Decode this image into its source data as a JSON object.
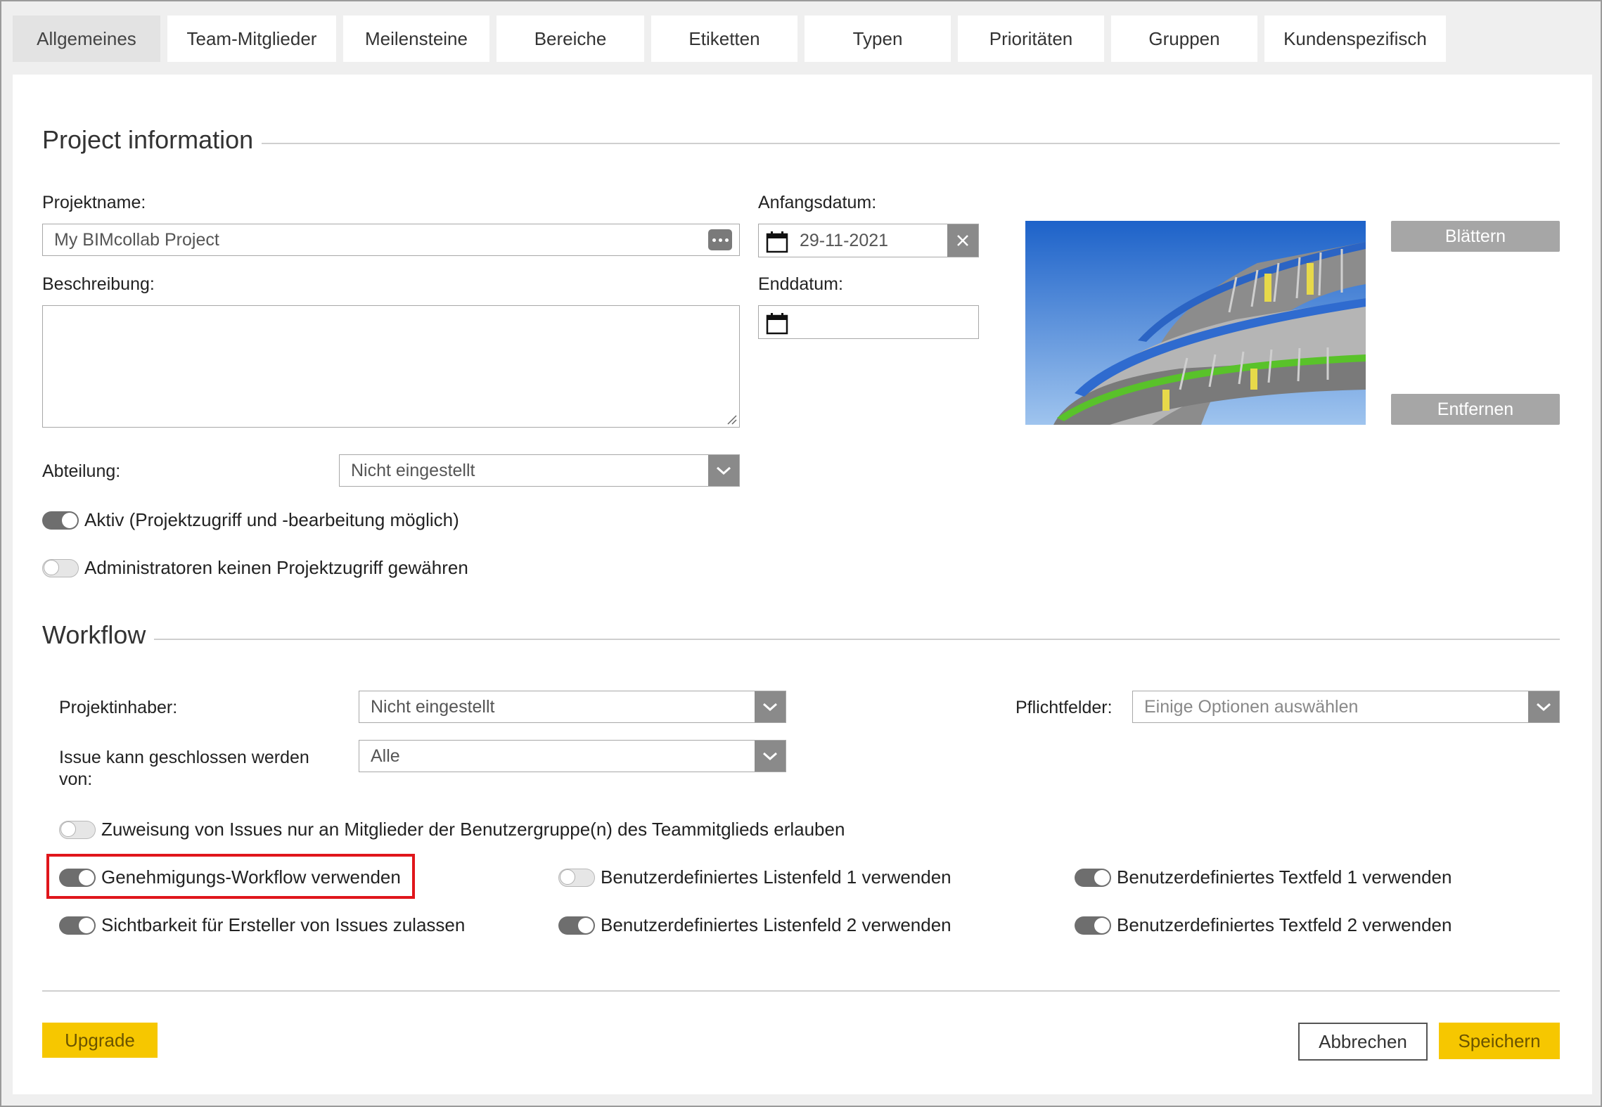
{
  "tabs": [
    {
      "label": "Allgemeines",
      "active": true
    },
    {
      "label": "Team-Mitglieder"
    },
    {
      "label": "Meilensteine"
    },
    {
      "label": "Bereiche"
    },
    {
      "label": "Etiketten"
    },
    {
      "label": "Typen"
    },
    {
      "label": "Prioritäten"
    },
    {
      "label": "Gruppen"
    },
    {
      "label": "Kundenspezifisch"
    }
  ],
  "project_info": {
    "title": "Project information",
    "name_label": "Projektname:",
    "name_value": "My BIMcollab Project",
    "description_label": "Beschreibung:",
    "description_value": "",
    "start_label": "Anfangsdatum:",
    "start_value": "29-11-2021",
    "end_label": "Enddatum:",
    "end_value": "",
    "browse_label": "Blättern",
    "remove_label": "Entfernen",
    "department_label": "Abteilung:",
    "department_value": "Nicht eingestellt",
    "toggle_active": {
      "label": "Aktiv (Projektzugriff und -bearbeitung möglich)",
      "on": true
    },
    "toggle_admin": {
      "label": "Administratoren keinen Projektzugriff gewähren",
      "on": false
    }
  },
  "workflow": {
    "title": "Workflow",
    "owner_label": "Projektinhaber:",
    "owner_value": "Nicht eingestellt",
    "close_label": "Issue kann geschlossen werden von:",
    "close_value": "Alle",
    "required_label": "Pflichtfelder:",
    "required_placeholder": "Einige Optionen auswählen",
    "toggle_assign": {
      "label": "Zuweisung von Issues nur an Mitglieder der Benutzergruppe(n) des Teammitglieds erlauben",
      "on": false
    },
    "toggle_approval": {
      "label": "Genehmigungs-Workflow verwenden",
      "on": true
    },
    "toggle_visibility": {
      "label": "Sichtbarkeit für Ersteller von Issues zulassen",
      "on": true
    },
    "toggle_list1": {
      "label": "Benutzerdefiniertes Listenfeld 1 verwenden",
      "on": false
    },
    "toggle_list2": {
      "label": "Benutzerdefiniertes Listenfeld 2 verwenden",
      "on": true
    },
    "toggle_text1": {
      "label": "Benutzerdefiniertes Textfeld 1 verwenden",
      "on": true
    },
    "toggle_text2": {
      "label": "Benutzerdefiniertes Textfeld 2 verwenden",
      "on": true
    }
  },
  "footer": {
    "upgrade_label": "Upgrade",
    "cancel_label": "Abbrechen",
    "save_label": "Speichern"
  },
  "colors": {
    "accent_yellow": "#f6c700",
    "highlight_red": "#e0161b",
    "toggle_on": "#6e6e6e"
  }
}
